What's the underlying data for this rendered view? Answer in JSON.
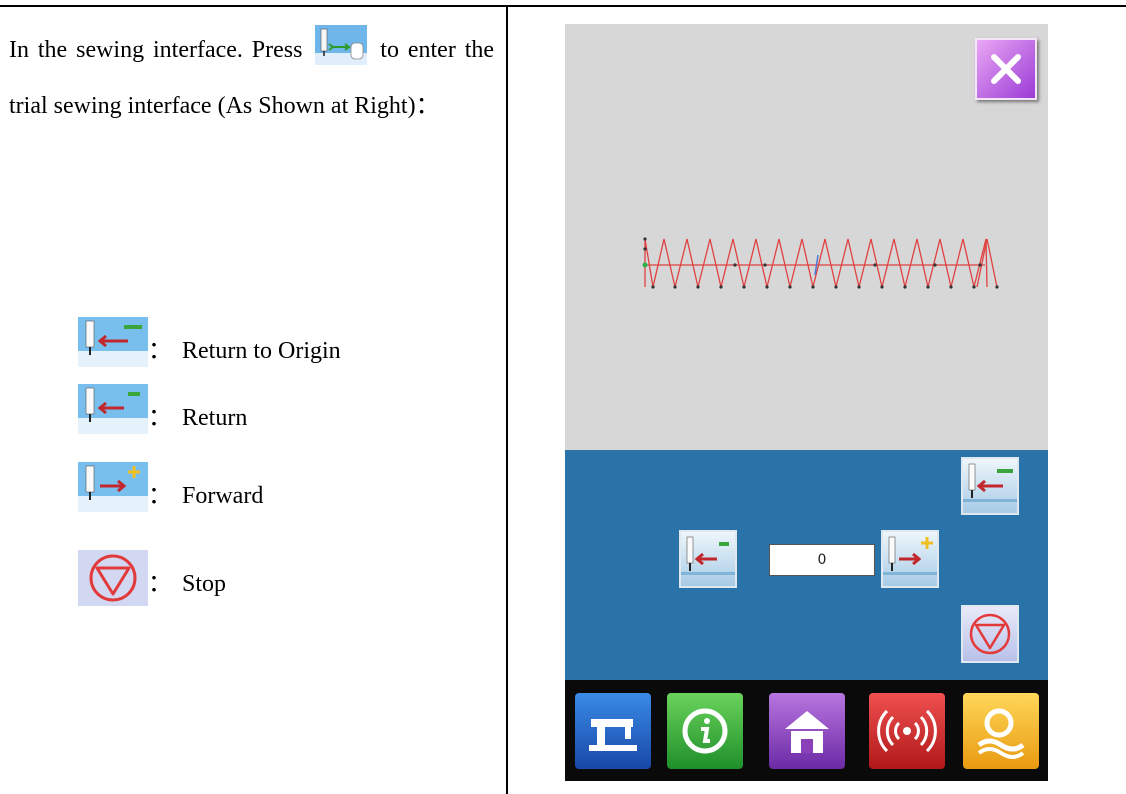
{
  "intro": {
    "text_before": "In the sewing interface. Press",
    "text_after": "to enter the trial sewing interface (As Shown at Right)：",
    "icon": "trial-sewing-icon"
  },
  "legend": [
    {
      "icon": "return-to-origin-icon",
      "sep": "：",
      "label": "Return to Origin"
    },
    {
      "icon": "return-icon",
      "sep": "：",
      "label": "Return"
    },
    {
      "icon": "forward-icon",
      "sep": "：",
      "label": "Forward"
    },
    {
      "icon": "stop-icon",
      "sep": "：",
      "label": "Stop"
    }
  ],
  "screen": {
    "close_icon": "close-icon",
    "stitch_count": "0",
    "buttons": {
      "origin": "return-to-origin-icon",
      "return": "return-icon",
      "forward": "forward-icon",
      "stop": "stop-icon"
    },
    "tabs": [
      {
        "icon": "sewing-machine-icon",
        "color": "#1f5fc0"
      },
      {
        "icon": "info-icon",
        "color": "#2fa53a"
      },
      {
        "icon": "home-icon",
        "color": "#8b3fb8"
      },
      {
        "icon": "signal-icon",
        "color": "#d42a2a"
      },
      {
        "icon": "search-icon",
        "color": "#f2b82a"
      }
    ]
  },
  "colors": {
    "screen_bg": "#d7d7d7",
    "control_bg": "#2a73a8",
    "stitch_line": "#e04040"
  }
}
